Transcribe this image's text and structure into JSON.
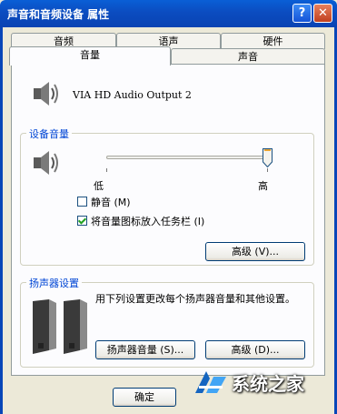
{
  "window": {
    "title": "声音和音频设备 属性",
    "help_label": "?",
    "close_label": "✕"
  },
  "tabs": {
    "back_row": [
      "音频",
      "语声",
      "硬件"
    ],
    "front_row": [
      "音量",
      "声音"
    ],
    "active": "音量"
  },
  "device": {
    "name": "VIA HD Audio Output 2",
    "icon": "speaker-icon"
  },
  "device_volume": {
    "legend": "设备音量",
    "slider_low": "低",
    "slider_high": "高",
    "slider_value": 1.0,
    "mute_label": "静音 (M)",
    "mute_checked": false,
    "tray_label": "将音量图标放入任务栏 (I)",
    "tray_checked": true,
    "advanced_label": "高级 (V)..."
  },
  "speaker_settings": {
    "legend": "扬声器设置",
    "description": "用下列设置更改每个扬声器音量和其他设置。",
    "speaker_volume_label": "扬声器音量 (S)...",
    "advanced_label": "高级 (D)..."
  },
  "footer": {
    "ok_label": "确定"
  },
  "watermark": {
    "text": "系统之家"
  },
  "colors": {
    "title_bar": "#0b4cc0",
    "group_legend": "#0046d5",
    "dialog_bg": "#ece9d8"
  }
}
